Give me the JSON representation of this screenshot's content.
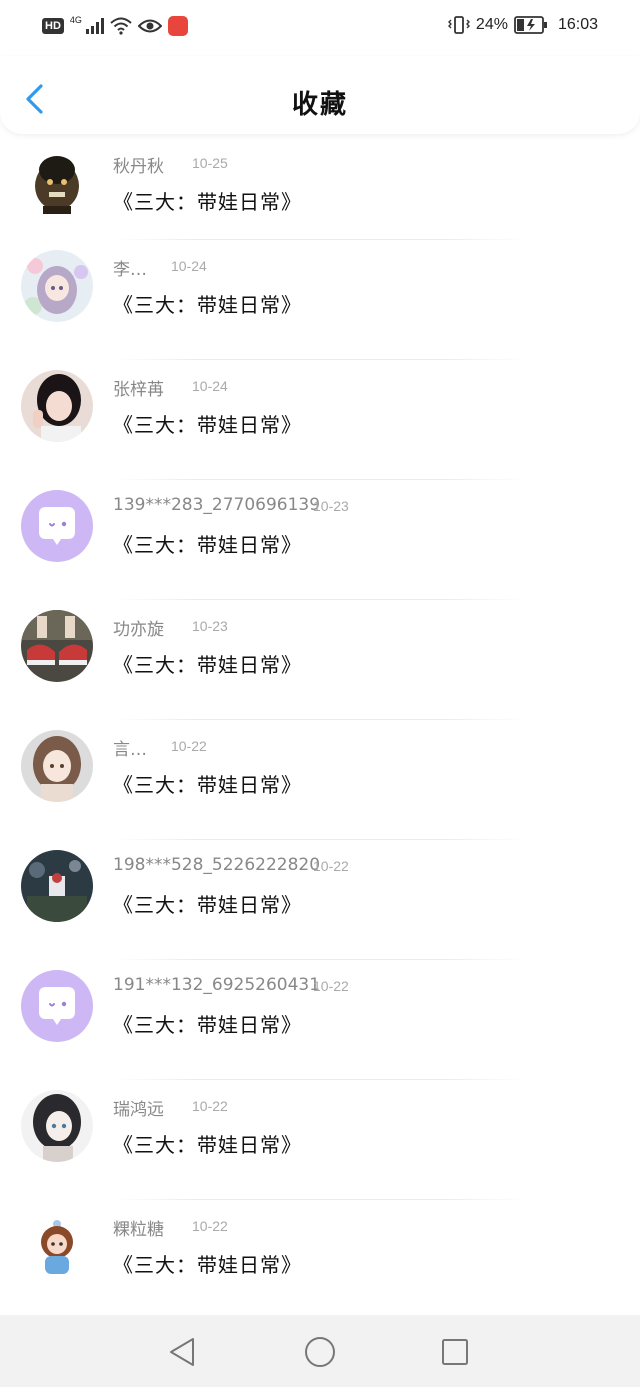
{
  "status_bar": {
    "hd": "HD",
    "network": "4G",
    "battery": "24%",
    "time": "16:03"
  },
  "header": {
    "title": "收藏"
  },
  "items": [
    {
      "user": "秋丹秋",
      "date": "10-25",
      "title": "《三大：带娃日常》",
      "avatar": "monster-avatar"
    },
    {
      "user": "李…",
      "date": "10-24",
      "title": "《三大：带娃日常》",
      "avatar": "anime-girl-avatar"
    },
    {
      "user": "张梓苒",
      "date": "10-24",
      "title": "《三大：带娃日常》",
      "avatar": "girl-photo-avatar"
    },
    {
      "user": "139***283_2770696139",
      "date": "10-23",
      "title": "《三大：带娃日常》",
      "avatar": "default-chat-avatar"
    },
    {
      "user": "功亦旋",
      "date": "10-23",
      "title": "《三大：带娃日常》",
      "avatar": "shoes-avatar"
    },
    {
      "user": "言…",
      "date": "10-22",
      "title": "《三大：带娃日常》",
      "avatar": "illustration-girl-avatar"
    },
    {
      "user": "198***528_5226222820",
      "date": "10-22",
      "title": "《三大：带娃日常》",
      "avatar": "dark-scene-avatar"
    },
    {
      "user": "191***132_6925260431",
      "date": "10-22",
      "title": "《三大：带娃日常》",
      "avatar": "default-chat-avatar"
    },
    {
      "user": "瑞鸿远",
      "date": "10-22",
      "title": "《三大：带娃日常》",
      "avatar": "sketch-girl-avatar"
    },
    {
      "user": "粿粒糖",
      "date": "10-22",
      "title": "《三大：带娃日常》",
      "avatar": "cartoon-girl-avatar"
    }
  ],
  "colors": {
    "accent": "#2f9bf0",
    "default_avatar_bg": "#cdb8f5",
    "nav_bg": "#f2f2f2"
  }
}
